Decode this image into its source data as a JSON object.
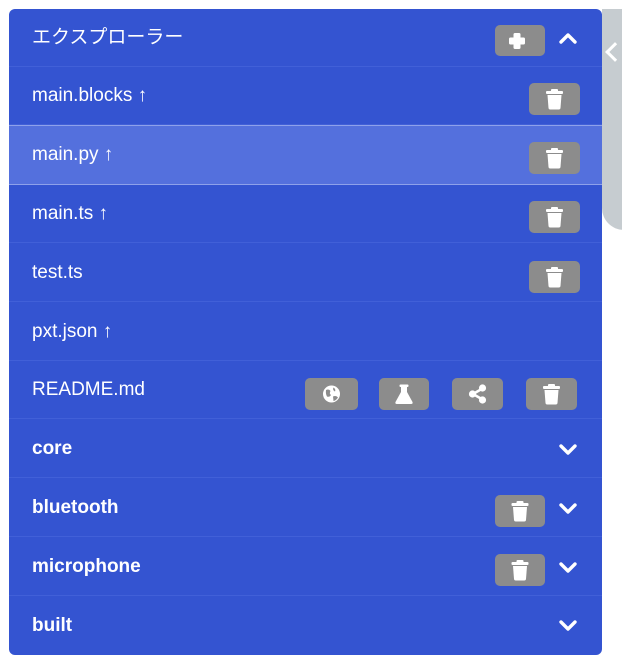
{
  "explorer": {
    "title": "エクスプローラー"
  },
  "files": [
    {
      "name": "main.blocks ↑"
    },
    {
      "name": "main.py ↑"
    },
    {
      "name": "main.ts ↑"
    },
    {
      "name": "test.ts"
    },
    {
      "name": "pxt.json ↑"
    },
    {
      "name": "README.md"
    }
  ],
  "packages": [
    {
      "name": "core"
    },
    {
      "name": "bluetooth"
    },
    {
      "name": "microphone"
    },
    {
      "name": "built"
    }
  ],
  "colors": {
    "panel": "#3454d1",
    "selected_row": "#5470dd",
    "button": "#8c8c8c",
    "side_tab": "#c6ccd0"
  }
}
